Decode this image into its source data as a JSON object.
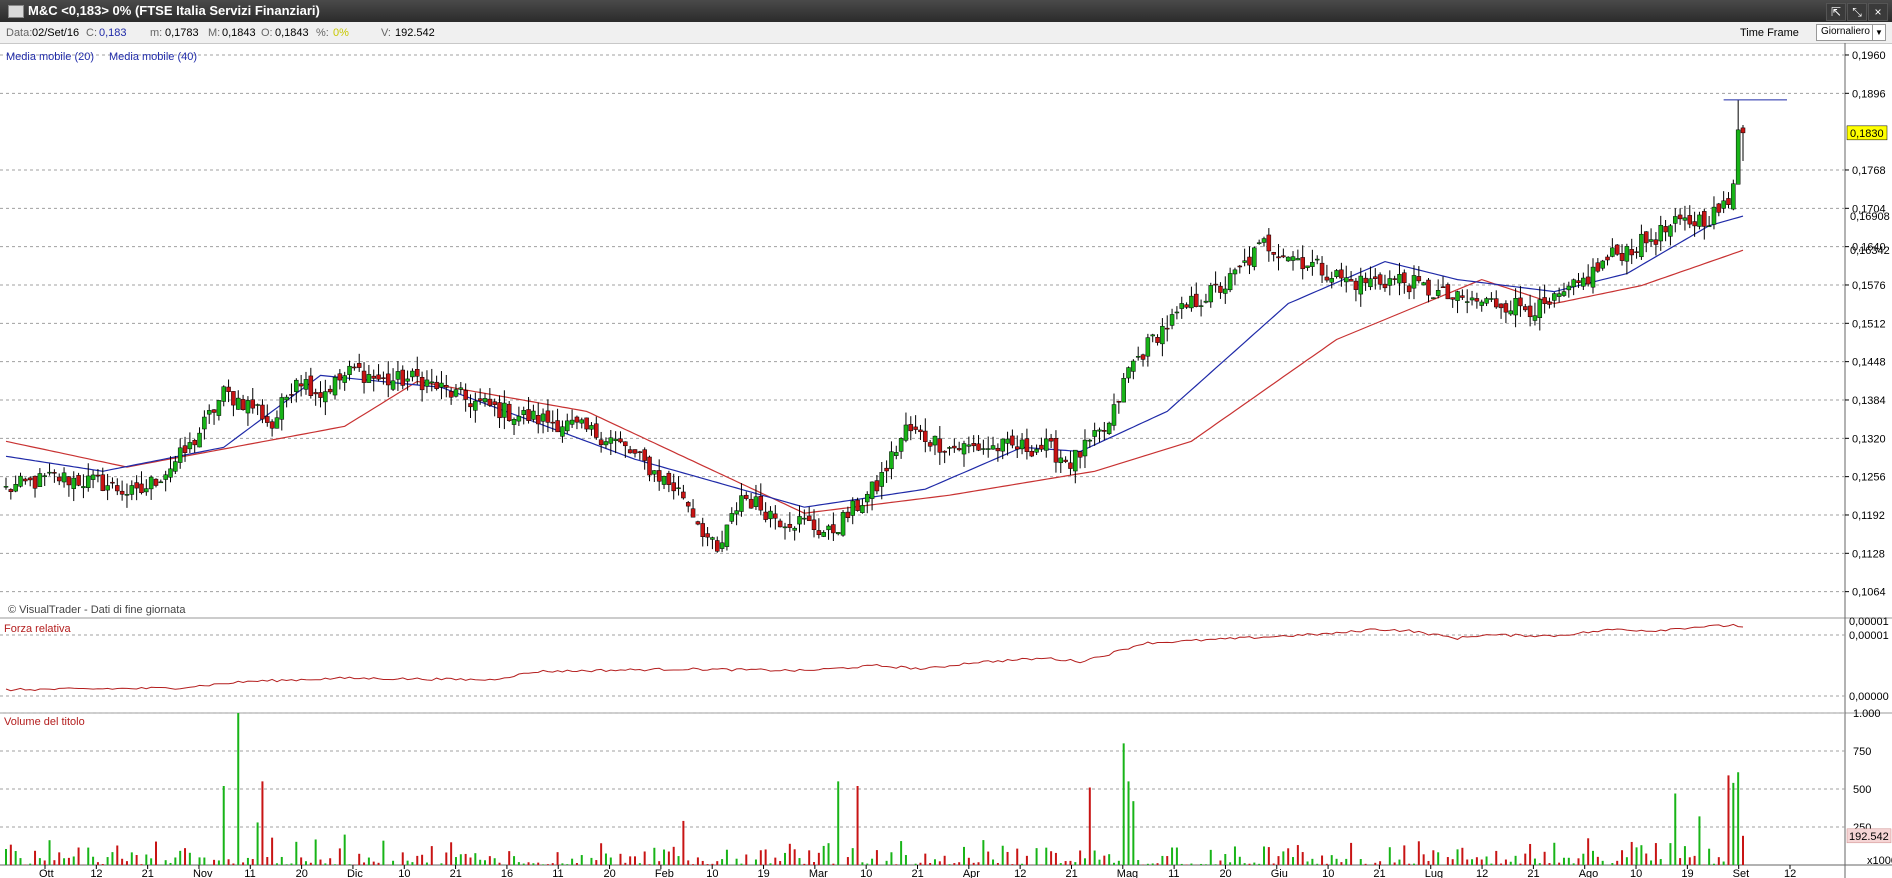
{
  "window": {
    "title": "M&C <0,183> 0%  (FTSE Italia Servizi Finanziari)",
    "buttons": [
      "⇱",
      "⤡",
      "×"
    ]
  },
  "infobar": {
    "data_label": "Data:",
    "data_value": "02/Set/16",
    "c_label": "C:",
    "c_value": "0,183",
    "m_label": "m:",
    "m_value": "0,1783",
    "m2_label": "M:",
    "m2_value": "0,1843",
    "o_label": "O:",
    "o_value": "0,1843",
    "pct_label": "%:",
    "pct_value": "0%",
    "v_label": "V:",
    "v_value": "192.542",
    "timeframe_label": "Time Frame",
    "timeframe_value": "Giornaliero"
  },
  "colors": {
    "up": "#18b418",
    "down": "#c81414",
    "ma20": "#1f2aa8",
    "ma40": "#c83232",
    "rs": "#b41e1e",
    "grid": "#a0a0a0",
    "last_price_bg": "#ffff00"
  },
  "chart_data": [
    {
      "type": "candlestick",
      "legend": [
        "Media mobile (20)",
        "Media mobile (40)"
      ],
      "credit": "© VisualTrader - Dati di fine giornata",
      "y_ticks": [
        "0,1960",
        "0,1896",
        "0,1768",
        "0,1704",
        "0,1640",
        "0,1576",
        "0,1512",
        "0,1448",
        "0,1384",
        "0,1320",
        "0,1256",
        "0,1192",
        "0,1128",
        "0,1064"
      ],
      "ylim": [
        0.102,
        0.198
      ],
      "last_price_label": "0,1830",
      "ma20_label": "0,16908",
      "ma40_label": "0,16342",
      "x_ticks": [
        "Ott",
        "12",
        "21",
        "Nov",
        "11",
        "20",
        "Dic",
        "10",
        "21",
        "16",
        "11",
        "20",
        "Feb",
        "10",
        "19",
        "Mar",
        "10",
        "21",
        "Apr",
        "12",
        "21",
        "Mag",
        "11",
        "20",
        "Giu",
        "10",
        "21",
        "Lug",
        "12",
        "21",
        "Ago",
        "10",
        "19",
        "Set",
        "12"
      ],
      "x_tick_highlight": "16",
      "close_anchors": [
        [
          0.1235,
          0
        ],
        [
          0.1255,
          10
        ],
        [
          0.1245,
          20
        ],
        [
          0.1225,
          27
        ],
        [
          0.1265,
          33
        ],
        [
          0.1305,
          38
        ],
        [
          0.1395,
          45
        ],
        [
          0.137,
          52
        ],
        [
          0.134,
          55
        ],
        [
          0.1425,
          60
        ],
        [
          0.1395,
          65
        ],
        [
          0.1435,
          72
        ],
        [
          0.1415,
          78
        ],
        [
          0.142,
          85
        ],
        [
          0.1385,
          95
        ],
        [
          0.136,
          105
        ],
        [
          0.1345,
          115
        ],
        [
          0.132,
          125
        ],
        [
          0.129,
          130
        ],
        [
          0.1225,
          140
        ],
        [
          0.1125,
          147
        ],
        [
          0.1225,
          152
        ],
        [
          0.1185,
          160
        ],
        [
          0.118,
          165
        ],
        [
          0.116,
          170
        ],
        [
          0.124,
          180
        ],
        [
          0.1335,
          186
        ],
        [
          0.1305,
          195
        ],
        [
          0.1305,
          205
        ],
        [
          0.1305,
          215
        ],
        [
          0.128,
          220
        ],
        [
          0.134,
          228
        ],
        [
          0.1435,
          232
        ],
        [
          0.1495,
          238
        ],
        [
          0.1545,
          245
        ],
        [
          0.1575,
          252
        ],
        [
          0.1645,
          260
        ],
        [
          0.161,
          270
        ],
        [
          0.158,
          278
        ],
        [
          0.1585,
          288
        ],
        [
          0.155,
          300
        ],
        [
          0.1545,
          310
        ],
        [
          0.1535,
          318
        ],
        [
          0.1575,
          325
        ],
        [
          0.1625,
          332
        ],
        [
          0.1645,
          338
        ],
        [
          0.1675,
          345
        ],
        [
          0.169,
          352
        ],
        [
          0.171,
          356
        ],
        [
          0.1745,
          357
        ],
        [
          0.1835,
          358
        ],
        [
          0.183,
          359
        ]
      ],
      "ma20_anchors": [
        [
          0.129,
          0
        ],
        [
          0.1265,
          20
        ],
        [
          0.1305,
          45
        ],
        [
          0.1425,
          65
        ],
        [
          0.1405,
          90
        ],
        [
          0.1285,
          130
        ],
        [
          0.1205,
          165
        ],
        [
          0.1235,
          190
        ],
        [
          0.1305,
          210
        ],
        [
          0.1298,
          222
        ],
        [
          0.1365,
          240
        ],
        [
          0.1545,
          265
        ],
        [
          0.1615,
          285
        ],
        [
          0.1585,
          300
        ],
        [
          0.1565,
          320
        ],
        [
          0.1595,
          335
        ],
        [
          0.1675,
          352
        ],
        [
          0.1691,
          359
        ]
      ],
      "ma40_anchors": [
        [
          0.1315,
          0
        ],
        [
          0.1272,
          25
        ],
        [
          0.134,
          70
        ],
        [
          0.1415,
          85
        ],
        [
          0.1365,
          120
        ],
        [
          0.1195,
          165
        ],
        [
          0.1225,
          195
        ],
        [
          0.1265,
          225
        ],
        [
          0.1315,
          245
        ],
        [
          0.1485,
          275
        ],
        [
          0.1585,
          305
        ],
        [
          0.1545,
          320
        ],
        [
          0.1575,
          338
        ],
        [
          0.1634,
          359
        ]
      ]
    },
    {
      "type": "line",
      "title": "Forza relativa",
      "y_ticks": [
        "0,00001",
        "0,00000"
      ],
      "value_label": "0,00001",
      "rs_anchors": [
        [
          0.22,
          0
        ],
        [
          0.24,
          35
        ],
        [
          0.32,
          50
        ],
        [
          0.36,
          70
        ],
        [
          0.34,
          100
        ],
        [
          0.44,
          110
        ],
        [
          0.47,
          140
        ],
        [
          0.45,
          165
        ],
        [
          0.51,
          180
        ],
        [
          0.47,
          190
        ],
        [
          0.55,
          200
        ],
        [
          0.6,
          215
        ],
        [
          0.56,
          222
        ],
        [
          0.65,
          228
        ],
        [
          0.78,
          235
        ],
        [
          0.84,
          255
        ],
        [
          0.9,
          275
        ],
        [
          0.95,
          283
        ],
        [
          0.93,
          290
        ],
        [
          0.84,
          300
        ],
        [
          0.88,
          305
        ],
        [
          0.87,
          320
        ],
        [
          0.95,
          333
        ],
        [
          0.93,
          340
        ],
        [
          0.98,
          350
        ],
        [
          0.99,
          355
        ],
        [
          1.0,
          357
        ],
        [
          0.98,
          359
        ]
      ]
    },
    {
      "type": "bar",
      "title": "Volume del titolo",
      "y_ticks": [
        "1.000",
        "750",
        "500",
        "250"
      ],
      "ylim": [
        0,
        1000
      ],
      "y_unit": "x1000",
      "last_volume_label": "192.542",
      "big_bars": [
        [
          45,
          520
        ],
        [
          48,
          1000
        ],
        [
          52,
          280
        ],
        [
          53,
          550
        ],
        [
          55,
          180
        ],
        [
          70,
          200
        ],
        [
          140,
          290
        ],
        [
          172,
          550
        ],
        [
          176,
          520
        ],
        [
          224,
          510
        ],
        [
          231,
          800
        ],
        [
          232,
          550
        ],
        [
          233,
          420
        ],
        [
          345,
          470
        ],
        [
          350,
          320
        ],
        [
          356,
          590
        ],
        [
          357,
          540
        ],
        [
          358,
          610
        ],
        [
          359,
          192
        ]
      ]
    }
  ]
}
